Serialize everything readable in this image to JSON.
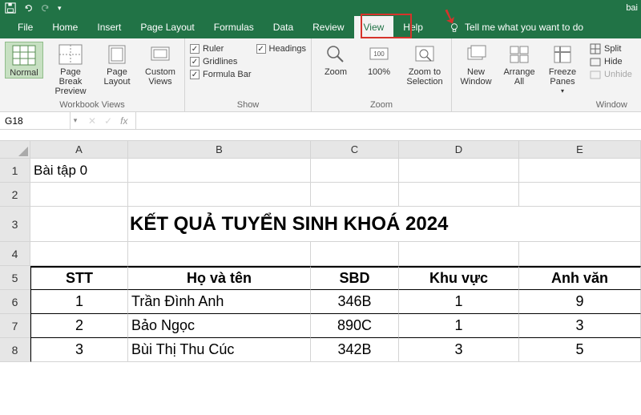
{
  "titlebar": {
    "filename_partial": "bai"
  },
  "menu": {
    "items": [
      "File",
      "Home",
      "Insert",
      "Page Layout",
      "Formulas",
      "Data",
      "Review",
      "View",
      "Help"
    ],
    "active": "View",
    "tell_me": "Tell me what you want to do"
  },
  "ribbon": {
    "workbook_views": {
      "label": "Workbook Views",
      "buttons": [
        "Normal",
        "Page Break Preview",
        "Page Layout",
        "Custom Views"
      ]
    },
    "show": {
      "label": "Show",
      "checks": [
        {
          "label": "Ruler",
          "checked": true
        },
        {
          "label": "Gridlines",
          "checked": true
        },
        {
          "label": "Formula Bar",
          "checked": true
        },
        {
          "label": "Headings",
          "checked": true
        }
      ]
    },
    "zoom": {
      "label": "Zoom",
      "buttons": [
        "Zoom",
        "100%",
        "Zoom to Selection"
      ]
    },
    "window": {
      "label": "Window",
      "big": [
        "New Window",
        "Arrange All",
        "Freeze Panes"
      ],
      "small": [
        "Split",
        "Hide",
        "Unhide"
      ]
    }
  },
  "formulabar": {
    "name": "G18",
    "fx": "fx"
  },
  "sheet": {
    "cols": [
      "A",
      "B",
      "C",
      "D",
      "E"
    ],
    "rows": [
      "1",
      "2",
      "3",
      "4",
      "5",
      "6",
      "7",
      "8"
    ],
    "a1": "Bài tập 0",
    "title": "KẾT QUẢ TUYỂN SINH KHOÁ 2024",
    "headers": [
      "STT",
      "Họ và tên",
      "SBD",
      "Khu vực",
      "Anh văn"
    ],
    "data": [
      {
        "stt": "1",
        "name": "Trần Đình Anh",
        "sbd": "346B",
        "kv": "1",
        "av": "9"
      },
      {
        "stt": "2",
        "name": "Bảo Ngọc",
        "sbd": "890C",
        "kv": "1",
        "av": "3"
      },
      {
        "stt": "3",
        "name": "Bùi Thị Thu Cúc",
        "sbd": "342B",
        "kv": "3",
        "av": "5"
      }
    ]
  }
}
